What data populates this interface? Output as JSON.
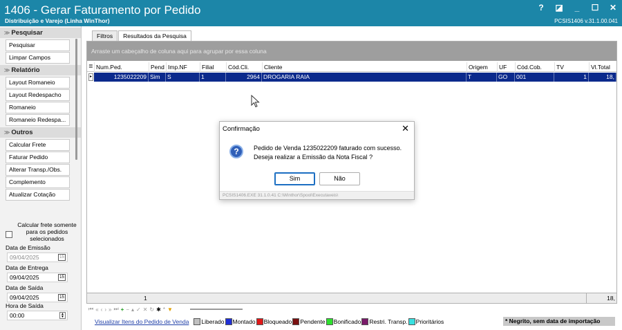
{
  "window": {
    "title": "1406 - Gerar Faturamento por Pedido",
    "subtitle": "Distribuição e Varejo (Linha WinThor)",
    "version": "PCSIS1406  v.31.1.00.041",
    "buttons": [
      "?",
      "◪",
      "_",
      "☐",
      "✕"
    ]
  },
  "sidebar": {
    "sections": [
      {
        "title": "Pesquisar",
        "items": [
          "Pesquisar",
          "Limpar Campos"
        ]
      },
      {
        "title": "Relatório",
        "items": [
          "Layout Romaneio",
          "Layout Redespacho",
          "Romaneio",
          "Romaneio Redespa..."
        ]
      },
      {
        "title": "Outros",
        "items": [
          "Calcular Frete",
          "Faturar Pedido",
          "Alterar Transp./Obs.",
          "Complemento",
          "Atualizar Cotação"
        ]
      }
    ]
  },
  "options": {
    "calc_frete_label": "Calcular frete somente para os pedidos selecionados",
    "data_emissao_label": "Data de Emissão",
    "data_emissao_value": "09/04/2025",
    "data_entrega_label": "Data de Entrega",
    "data_entrega_value": "09/04/2025",
    "data_saida_label": "Data de Saída",
    "data_saida_value": "09/04/2025",
    "hora_saida_label": "Hora de Saída",
    "hora_saida_value": "00:00",
    "calendar_glyph": "15"
  },
  "tabs": [
    "Filtros",
    "Resultados da Pesquisa"
  ],
  "grid": {
    "group_hint": "Arraste um cabeçalho de coluna aqui para agrupar por essa coluna",
    "columns": [
      "Num.Ped.",
      "Pend",
      "Imp.NF",
      "Filial",
      "Cód.Cli.",
      "Cliente",
      "Origem",
      "UF",
      "Cód.Cob.",
      "TV",
      "Vl.Total"
    ],
    "rows": [
      [
        "1235022209",
        "Sim",
        "S",
        "1",
        "2964",
        "DROGARIA RAIA",
        "T",
        "GO",
        "001",
        "1",
        "18,"
      ]
    ],
    "footer_count": "1",
    "footer_total": "18,"
  },
  "legend": {
    "link": "Visualizar Itens do Pedido de Venda",
    "items": [
      {
        "label": "Liberado",
        "color": "#c0c0c0"
      },
      {
        "label": "Montado",
        "color": "#1f2fd6"
      },
      {
        "label": "Bloqueado",
        "color": "#e01818"
      },
      {
        "label": "Pendente",
        "color": "#7a1010"
      },
      {
        "label": "Bonificado",
        "color": "#2ee02e"
      },
      {
        "label": "Restri. Transp.",
        "color": "#7a1a6a"
      },
      {
        "label": "Prioritários",
        "color": "#38e0e0"
      }
    ],
    "note": "* Negrito, sem data de importação"
  },
  "dialog": {
    "title": "Confirmação",
    "message_line1": "Pedido de Venda 1235022209 faturado com sucesso.",
    "message_line2": "Deseja realizar a Emissão da Nota Fiscal ?",
    "yes": "Sim",
    "no": "Não",
    "status": "PCSIS1406.EXE 31.1.0.41 C:\\Winthor\\Spool\\Executaveis\\"
  },
  "colors": {
    "titlebar": "#1c86a8",
    "selected_row": "#0c2a8c"
  }
}
